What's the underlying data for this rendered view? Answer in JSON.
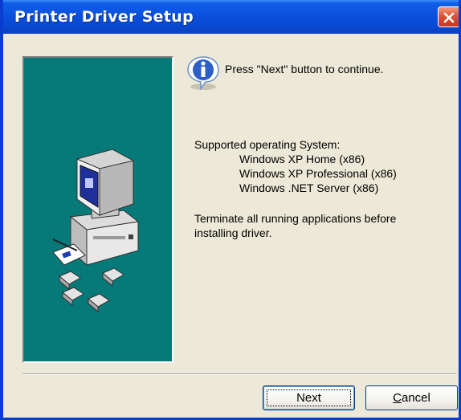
{
  "window": {
    "title": "Printer Driver Setup",
    "accent_color": "#0a4fdc",
    "panel_color": "#077979"
  },
  "content": {
    "instruction": "Press \"Next\" button to continue.",
    "supported_heading": "Supported operating System:",
    "os_list": [
      "Windows XP Home (x86)",
      "Windows XP Professional (x86)",
      "Windows .NET Server (x86)"
    ],
    "note_line1": "Terminate all running applications before",
    "note_line2": "installing driver."
  },
  "buttons": {
    "next": "Next",
    "cancel_prefix": "C",
    "cancel_rest": "ancel"
  },
  "icons": {
    "close": "close-icon",
    "info": "info-icon",
    "computer": "computer-illustration",
    "disks": "floppy-disks-illustration"
  }
}
